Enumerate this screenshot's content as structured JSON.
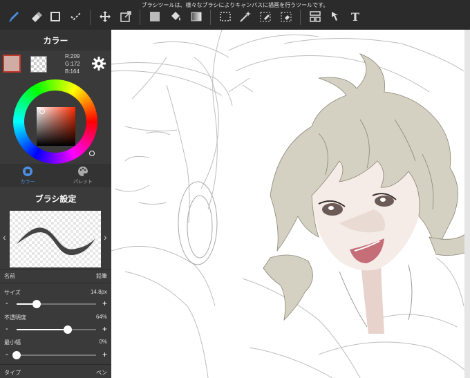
{
  "toolbar": {
    "tooltip": "ブラシツールは、様々なブラシによりキャンバスに描画を行うツールです。",
    "tools": [
      "brush-tool",
      "eraser-tool",
      "shape-tool",
      "select-brush-tool",
      "move-tool",
      "transform-tool",
      "fill-color",
      "bucket-tool",
      "gradient-tool",
      "rect-select-tool",
      "magic-wand-tool",
      "select-pen-tool",
      "select-eraser-tool",
      "layout-tool",
      "cursor-tool",
      "text-tool"
    ],
    "text_tool_label": "T"
  },
  "color_panel": {
    "title": "カラー",
    "main_color": "#d1aca4",
    "rgb": {
      "r": "R:209",
      "g": "G:172",
      "b": "B:164"
    },
    "tabs": {
      "color": "カラー",
      "palette": "パレット"
    }
  },
  "brush_panel": {
    "title": "ブラシ設定",
    "name_label": "名前",
    "name_value": "鉛筆",
    "size_label": "サイズ",
    "size_value": "14.8px",
    "size_level": 0.25,
    "opacity_label": "不透明度",
    "opacity_value": "64%",
    "opacity_level": 0.64,
    "min_width_label": "最小幅",
    "min_width_value": "0%",
    "min_width_level": 0.0,
    "type_label": "タイプ",
    "type_value": "ペン"
  }
}
